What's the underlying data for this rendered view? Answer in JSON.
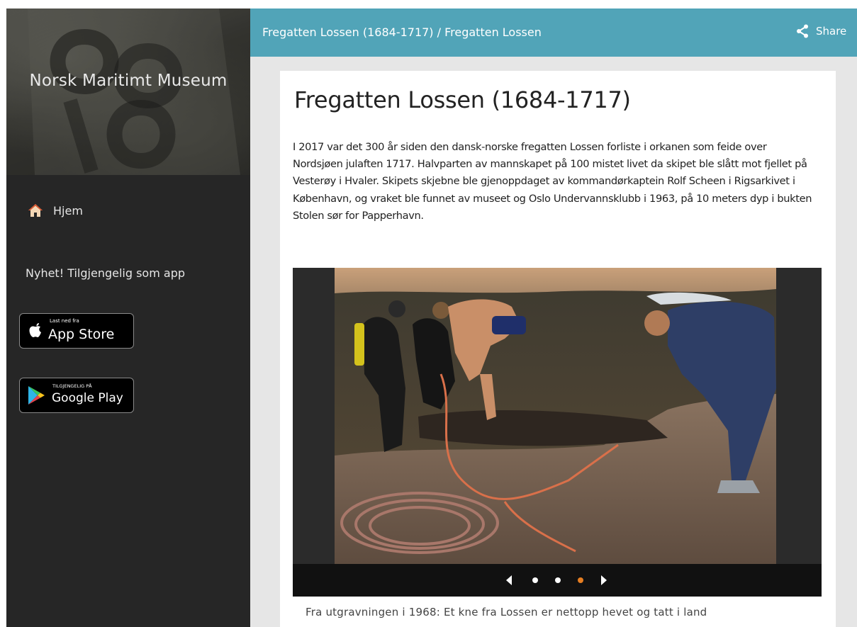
{
  "sidebar": {
    "title": "Norsk Maritimt Museum",
    "nav": [
      {
        "label": "Hjem",
        "icon": "home-icon"
      }
    ],
    "news_text": "Nyhet! Tilgjengelig som app",
    "app_store": {
      "small": "Last ned fra",
      "big": "App Store",
      "icon": "apple-icon"
    },
    "google_play": {
      "small": "TILGJENGELIG PÅ",
      "big": "Google Play",
      "icon": "google-play-icon"
    }
  },
  "header": {
    "breadcrumb": "Fregatten Lossen (1684-1717) / Fregatten Lossen",
    "share_label": "Share",
    "share_icon": "share-icon",
    "color": "#51a4b8"
  },
  "article": {
    "title": "Fregatten Lossen (1684-1717)",
    "intro": "I 2017 var det 300 år siden den dansk-norske fregatten Lossen forliste i orkanen som feide over Nordsjøen julaften 1717. Halvparten av mannskapet på 100 mistet livet da skipet ble slått mot fjellet på Vesterøy i Hvaler. Skipets skjebne ble gjenoppdaget av kommandørkaptein Rolf Scheen i Rigsarkivet i København, og vraket ble funnet av museet og Oslo Undervannsklubb i 1963, på 10 meters dyp i bukten Stolen sør for Papperhavn.",
    "carousel": {
      "slide_count": 3,
      "active_slide": 3,
      "active_dot_color": "#e67e22",
      "caption": "Fra utgravningen i 1968: Et kne fra Lossen er nettopp hevet og tatt i land"
    }
  }
}
